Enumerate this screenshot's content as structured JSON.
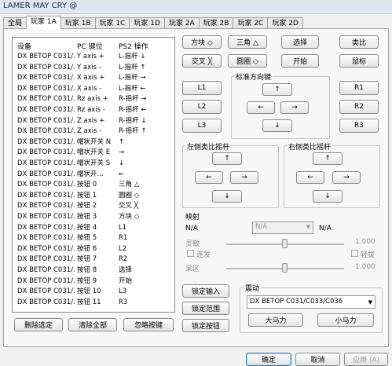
{
  "window": {
    "title": "LAMER MAY CRY @"
  },
  "tabs": [
    "全局",
    "玩家 1A",
    "玩家 1B",
    "玩家 1C",
    "玩家 1D",
    "玩家 2A",
    "玩家 2B",
    "玩家 2C",
    "玩家 2D"
  ],
  "active_tab": "玩家 1A",
  "list": {
    "headers": {
      "device": "设备",
      "pc_key": "PC 键位",
      "ps2_op": "PS2 操作"
    },
    "rows": [
      [
        "DX BETOP C031/...",
        "Y axis +",
        "L-摇杆 ↓"
      ],
      [
        "DX BETOP C031/...",
        "Y axis -",
        "L-摇杆 ↑"
      ],
      [
        "DX BETOP C031/...",
        "X axis +",
        "L-摇杆 →"
      ],
      [
        "DX BETOP C031/...",
        "X axis -",
        "L-摇杆 ←"
      ],
      [
        "DX BETOP C031/...",
        "Rz axis +",
        "R-摇杆 →"
      ],
      [
        "DX BETOP C031/...",
        "Rz axis -",
        "R-摇杆 ←"
      ],
      [
        "DX BETOP C031/...",
        "Z axis +",
        "R-摇杆 ↓"
      ],
      [
        "DX BETOP C031/...",
        "Z axis -",
        "R-摇杆 ↑"
      ],
      [
        "DX BETOP C031/...",
        "帽状开关 N",
        "↑"
      ],
      [
        "DX BETOP C031/...",
        "帽状开关 E",
        "→"
      ],
      [
        "DX BETOP C031/...",
        "帽状开关 S",
        "↓"
      ],
      [
        "DX BETOP C031/...",
        "帽状开...",
        "←"
      ],
      [
        "DX BETOP C031/...",
        "按钮 0",
        "三角 △"
      ],
      [
        "DX BETOP C031/...",
        "按钮 1",
        "圆圈 ◇"
      ],
      [
        "DX BETOP C031/...",
        "按钮 2",
        "交叉 ╳"
      ],
      [
        "DX BETOP C031/...",
        "按钮 3",
        "方块 ◇"
      ],
      [
        "DX BETOP C031/...",
        "按钮 4",
        "L1"
      ],
      [
        "DX BETOP C031/...",
        "按钮 5",
        "R1"
      ],
      [
        "DX BETOP C031/...",
        "按钮 6",
        "L2"
      ],
      [
        "DX BETOP C031/...",
        "按钮 7",
        "R2"
      ],
      [
        "DX BETOP C031/...",
        "按钮 8",
        "选择"
      ],
      [
        "DX BETOP C031/...",
        "按钮 9",
        "开始"
      ],
      [
        "DX BETOP C031/...",
        "按钮 10",
        "L3"
      ],
      [
        "DX BETOP C031/...",
        "按钮 11",
        "R3"
      ]
    ]
  },
  "list_buttons": {
    "delete": "删除选定",
    "clear": "清除全部",
    "ignore": "忽略按键"
  },
  "buttons": {
    "square": "方块 ◇",
    "triangle": "三角 △",
    "select": "选择",
    "analog": "类比",
    "cross": "交叉 ╳",
    "circle": "圆圈 ◇",
    "start": "开始",
    "mouse": "鼠标",
    "l1": "L1",
    "l2": "L2",
    "l3": "L3",
    "r1": "R1",
    "r2": "R2",
    "r3": "R3"
  },
  "arrows": {
    "up": "↑",
    "down": "↓",
    "left": "←",
    "right": "→"
  },
  "dpad": {
    "label": "标准方向键"
  },
  "left_stick": {
    "label": "左侧类比摇杆"
  },
  "right_stick": {
    "label": "右侧类比摇杆"
  },
  "mapping": {
    "label": "映射",
    "left_value": "N/A",
    "select_value": "N/A",
    "right_value": "N/A",
    "sensitivity_label": "灵敏",
    "sensitivity_value": "1.000",
    "sensitivity_level": 0.5,
    "turbo_label": "连发",
    "mouse_sens_label": "轻拔",
    "deadzone_label": "呆区",
    "deadzone_value": "1.000",
    "deadzone_level": 0.5
  },
  "lock_buttons": {
    "input": "锁定输入",
    "range": "锁定范围",
    "button": "锁定按钮"
  },
  "vibration": {
    "label": "震动",
    "device": "DX BETOP C031/C033/C036",
    "big_motor": "大马力",
    "small_motor": "小马力"
  },
  "dialog_buttons": {
    "ok": "确定",
    "cancel": "取消",
    "apply": "应用 (A)"
  }
}
